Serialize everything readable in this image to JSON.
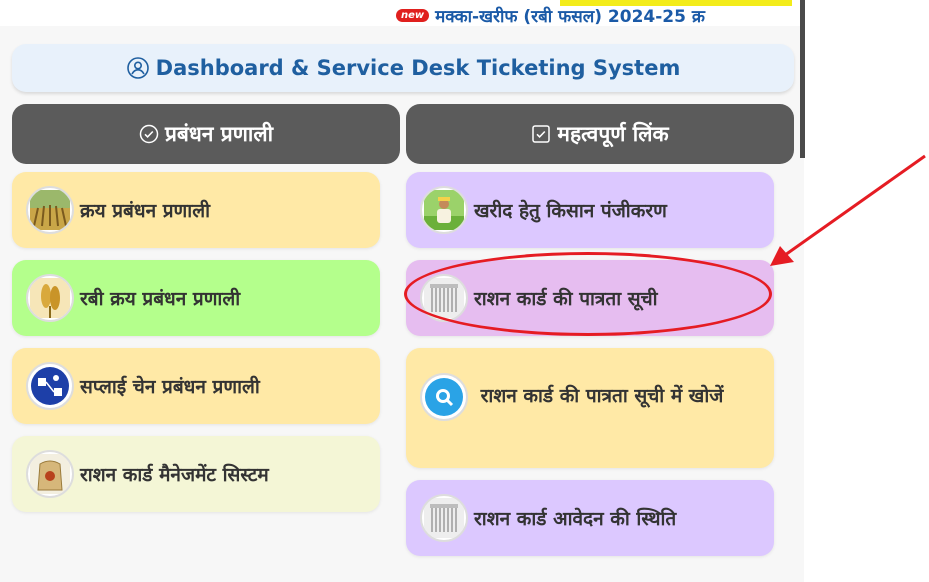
{
  "ticker": {
    "badge": "new",
    "text": "मक्का-खरीफ (रबी फसल) 2024-25 क्र"
  },
  "dashboard": {
    "label": "Dashboard & Service Desk Ticketing System"
  },
  "columns": {
    "left": {
      "title": "प्रबंधन प्रणाली",
      "items": [
        {
          "label": "क्रय प्रबंधन प्रणाली",
          "icon": "wheat-field-icon",
          "bg": "#ffe9a6"
        },
        {
          "label": "रबी क्रय प्रबंधन प्रणाली",
          "icon": "wheat-grain-icon",
          "bg": "#b4ff8c"
        },
        {
          "label": "सप्लाई चेन प्रबंधन प्रणाली",
          "icon": "supply-chain-icon",
          "bg": "#ffe9a6"
        },
        {
          "label": "राशन कार्ड मैनेजमेंट सिस्टम",
          "icon": "ration-sack-icon",
          "bg": "#f4f6d6"
        }
      ]
    },
    "right": {
      "title": "महत्वपूर्ण लिंक",
      "items": [
        {
          "label": "खरीद हेतु किसान पंजीकरण",
          "icon": "farmer-icon",
          "bg": "#dcc8ff"
        },
        {
          "label": "राशन कार्ड की पात्रता सूची",
          "icon": "document-list-icon",
          "bg": "#e6bdf0"
        },
        {
          "label": "राशन कार्ड की पात्रता सूची में खोजें",
          "icon": "search-icon",
          "bg": "#ffe9a6"
        },
        {
          "label": "राशन कार्ड आवेदन की स्थिति",
          "icon": "document-list-icon",
          "bg": "#dcc8ff"
        }
      ]
    }
  },
  "colors": {
    "header_bg": "#5b5b5b",
    "dashboard_text": "#1f5fa0",
    "ticker_text": "#1b5aa7",
    "highlight": "#e51c23"
  }
}
